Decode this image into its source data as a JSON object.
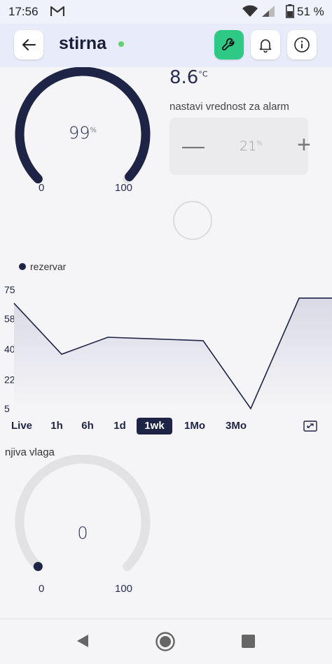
{
  "status_bar": {
    "time": "17:56",
    "notification_icon": "gmail-icon",
    "battery_percent": "51 %"
  },
  "header": {
    "title": "stirna",
    "online": true,
    "online_color": "#5fd36a",
    "buttons": [
      "back-arrow-icon",
      "wrench-icon",
      "bell-icon",
      "info-icon"
    ],
    "accent_color": "#2ec985"
  },
  "gauge_level": {
    "value": "99",
    "unit": "%",
    "min": "0",
    "max": "100",
    "fill_fraction": 0.99,
    "color": "#1e2446"
  },
  "temperature": {
    "value": "8.6",
    "unit": "°C"
  },
  "alarm": {
    "label": "nastavi vrednost za alarm",
    "value": "21",
    "unit": "%",
    "minus": "—",
    "plus": "+"
  },
  "chart_data": {
    "type": "area",
    "series": [
      {
        "name": "rezervar",
        "values": [
          67,
          37,
          47,
          46,
          45,
          5,
          70,
          70
        ]
      }
    ],
    "y_ticks": [
      "75",
      "58",
      "40",
      "22",
      "5"
    ],
    "ylim": [
      5,
      75
    ],
    "color": "#1e2446"
  },
  "time_ranges": {
    "options": [
      "Live",
      "1h",
      "6h",
      "1d",
      "1wk",
      "1Mo",
      "3Mo"
    ],
    "selected": "1wk"
  },
  "gauge_humidity": {
    "label": "njiva vlaga",
    "value": "0",
    "min": "0",
    "max": "100",
    "fill_fraction": 0
  },
  "nav": [
    "back-triangle-icon",
    "home-circle-icon",
    "recents-square-icon"
  ]
}
